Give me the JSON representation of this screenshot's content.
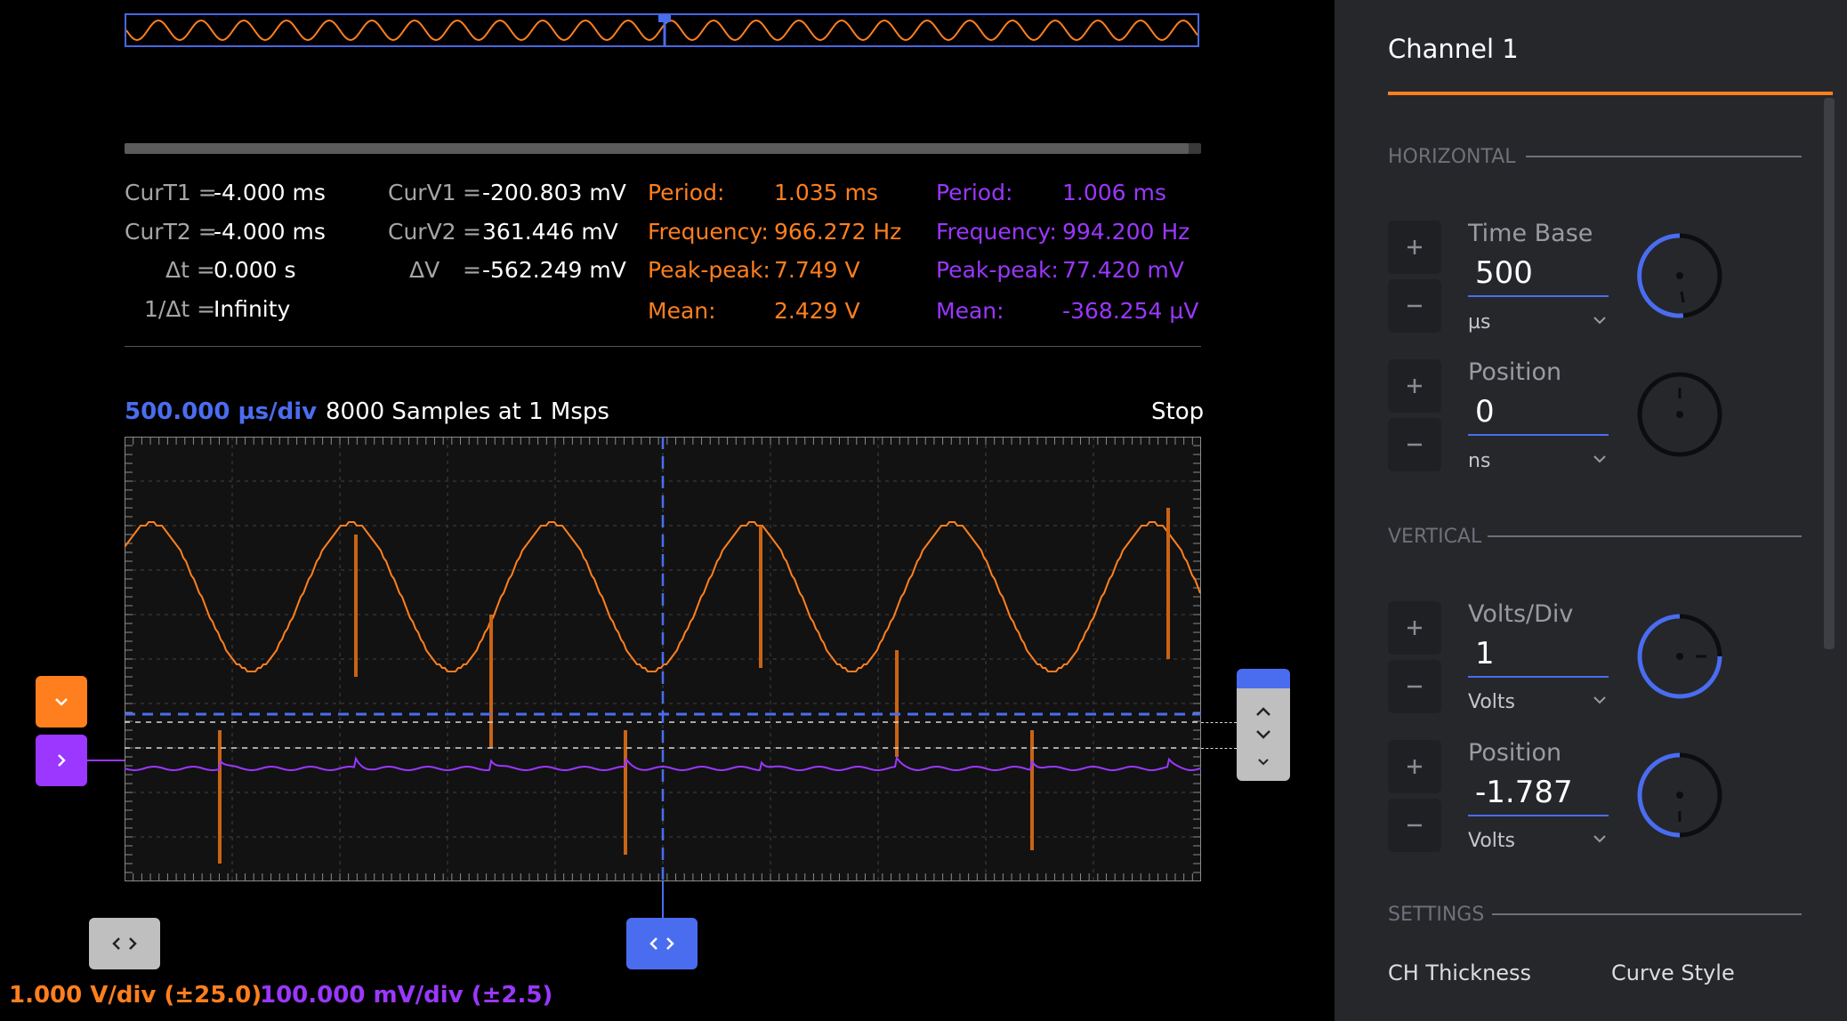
{
  "measurements": {
    "cursors_time": [
      {
        "label": "CurT1 =",
        "value": "-4.000 ms"
      },
      {
        "label": "CurT2 =",
        "value": "-4.000 ms"
      },
      {
        "label": "Δt =",
        "value": "0.000 s"
      },
      {
        "label": "1/Δt =",
        "value": "Infinity"
      }
    ],
    "cursors_voltage": [
      {
        "label": "CurV1",
        "eq": "=",
        "value": "-200.803 mV"
      },
      {
        "label": "CurV2",
        "eq": "=",
        "value": "361.446 mV"
      },
      {
        "label": "ΔV",
        "eq": "=",
        "value": "-562.249 mV"
      }
    ],
    "channel1": [
      {
        "label": "Period:",
        "value": "1.035 ms"
      },
      {
        "label": "Frequency:",
        "value": "966.272 Hz"
      },
      {
        "label": "Peak-peak:",
        "value": "7.749 V"
      },
      {
        "label": "Mean:",
        "value": "2.429 V"
      }
    ],
    "channel2": [
      {
        "label": "Period:",
        "value": "1.006 ms"
      },
      {
        "label": "Frequency:",
        "value": "994.200 Hz"
      },
      {
        "label": "Peak-peak:",
        "value": "77.420 mV"
      },
      {
        "label": "Mean:",
        "value": "-368.254 µV"
      }
    ]
  },
  "plot_header": {
    "timebase": "500.000 µs/div",
    "samples": "8000 Samples at 1 Msps",
    "run_state": "Stop"
  },
  "scales": {
    "ch1": "1.000 V/div (±25.0)",
    "ch2": "100.000 mV/div (±2.5)"
  },
  "panel": {
    "title": "Channel 1",
    "horizontal": {
      "heading": "HORIZONTAL",
      "time_base": {
        "label": "Time Base",
        "value": "500",
        "unit": "µs"
      },
      "position": {
        "label": "Position",
        "value": "0",
        "unit": "ns"
      }
    },
    "vertical": {
      "heading": "VERTICAL",
      "volts_div": {
        "label": "Volts/Div",
        "value": "1",
        "unit": "Volts"
      },
      "position": {
        "label": "Position",
        "value": "-1.787",
        "unit": "Volts"
      }
    },
    "settings": {
      "heading": "SETTINGS",
      "thickness_label": "CH Thickness",
      "style_label": "Curve Style"
    }
  },
  "colors": {
    "ch1": "#ff7f1e",
    "ch2": "#9b37ff",
    "accent": "#4a6df0",
    "panel_bg": "#26272b"
  },
  "icons": {
    "ch1_marker": "chevron-down-icon",
    "ch2_marker": "chevron-right-icon",
    "cursor_handle": "left-right-arrows-icon",
    "trigger_panel": "up-down-chevrons-icon",
    "plus": "plus-icon",
    "minus": "minus-icon"
  }
}
